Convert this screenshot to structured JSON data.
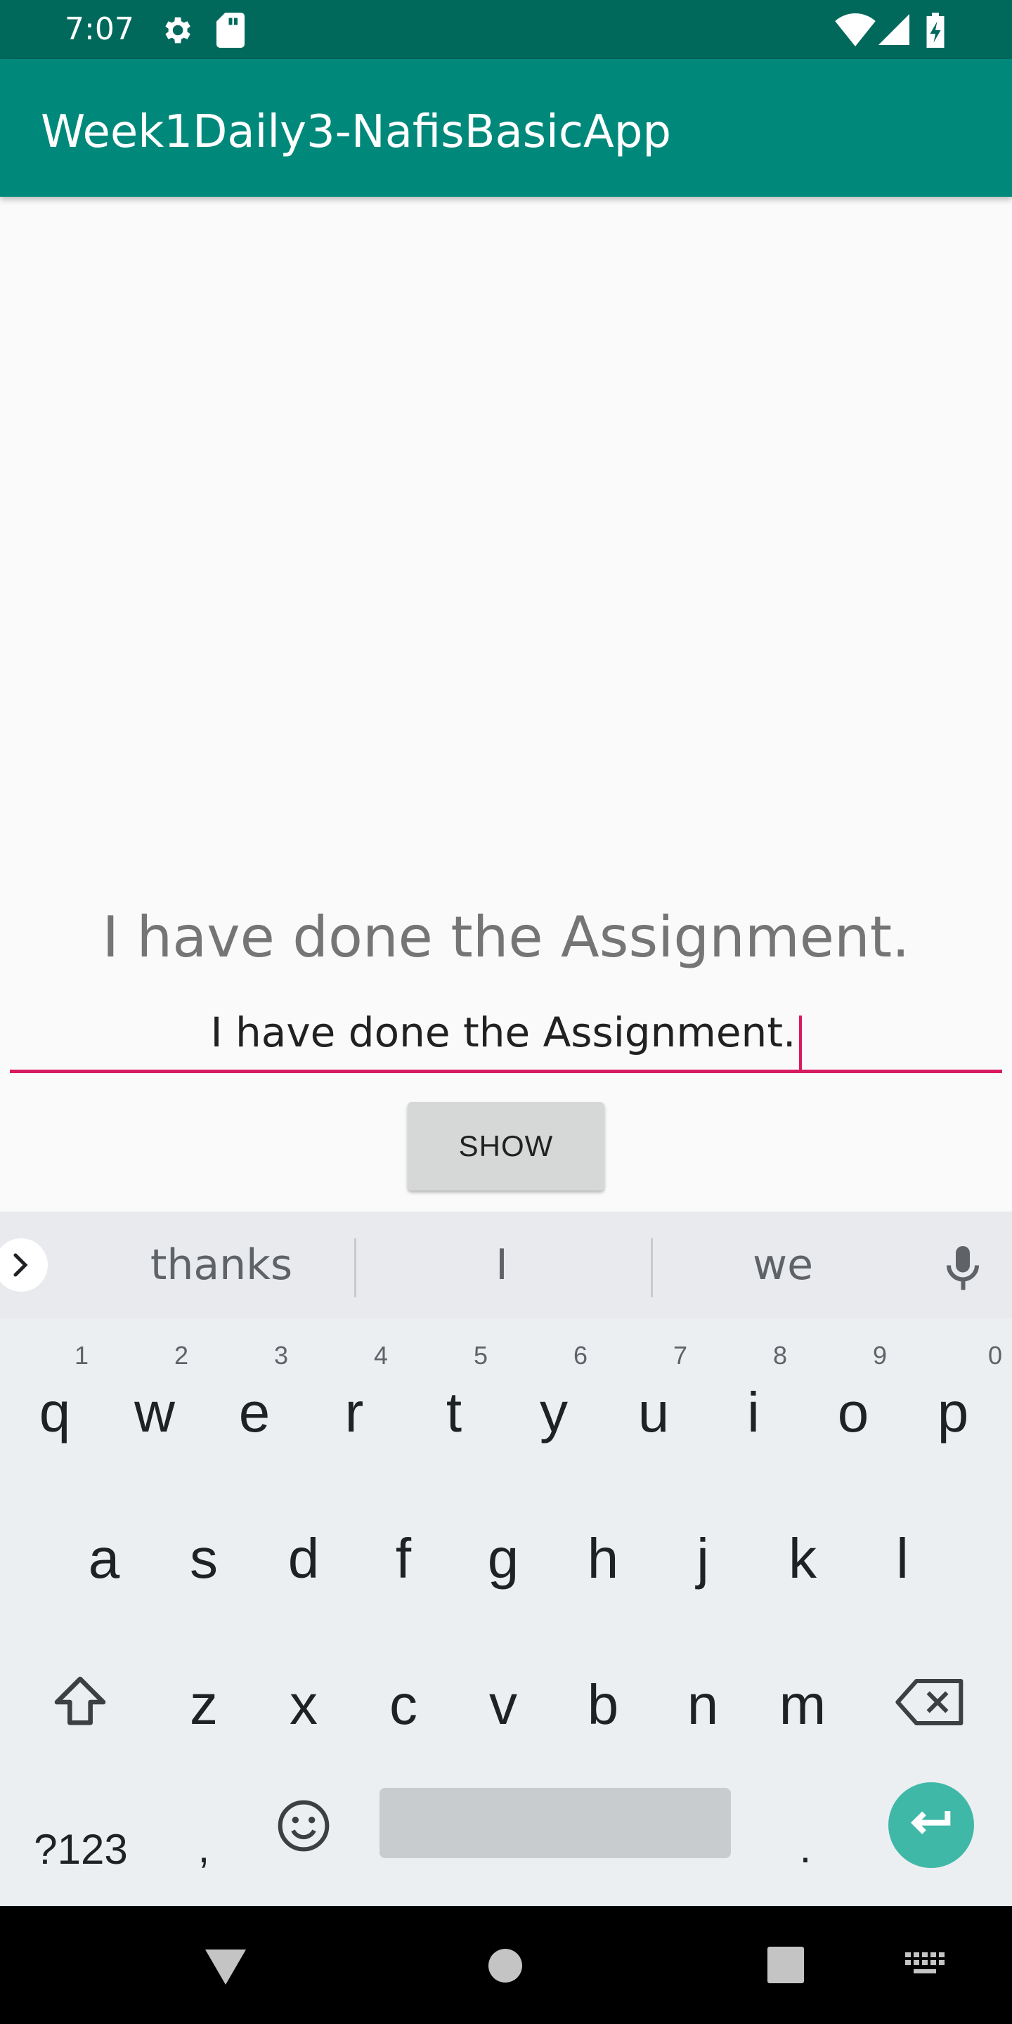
{
  "status_bar": {
    "time": "7:07"
  },
  "app_bar": {
    "title": "Week1Daily3-NafisBasicApp"
  },
  "main": {
    "display_text": "I have done the Assignment.",
    "input_value": "I have done the Assignment.",
    "show_button_label": "SHOW"
  },
  "keyboard": {
    "suggestions": [
      "thanks",
      "I",
      "we"
    ],
    "row1": [
      "q",
      "w",
      "e",
      "r",
      "t",
      "y",
      "u",
      "i",
      "o",
      "p"
    ],
    "row1_hints": [
      "1",
      "2",
      "3",
      "4",
      "5",
      "6",
      "7",
      "8",
      "9",
      "0"
    ],
    "row2": [
      "a",
      "s",
      "d",
      "f",
      "g",
      "h",
      "j",
      "k",
      "l"
    ],
    "row3": [
      "z",
      "x",
      "c",
      "v",
      "b",
      "n",
      "m"
    ],
    "symbols_label": "?123",
    "comma_label": ",",
    "period_label": "."
  },
  "colors": {
    "primary": "#00897b",
    "primary_dark": "#00695c",
    "accent": "#d81b60",
    "enter_key": "#3fb8a8"
  }
}
